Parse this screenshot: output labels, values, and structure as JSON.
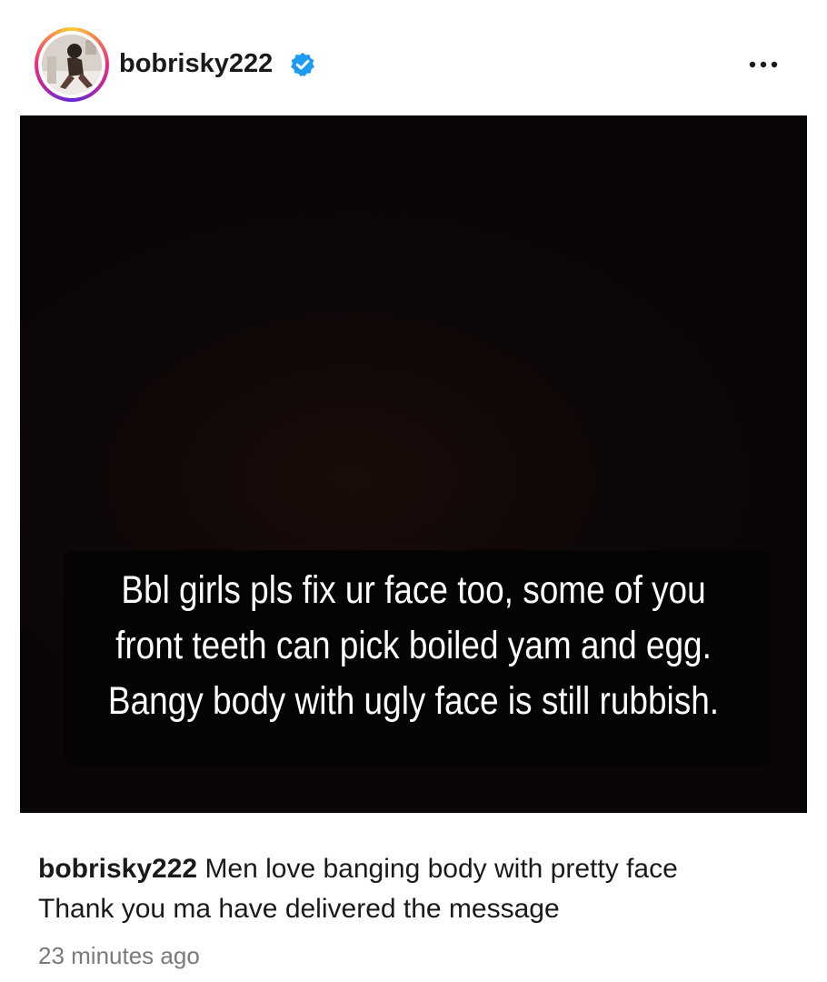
{
  "post": {
    "username": "bobrisky222",
    "verified": true,
    "verified_icon": "verified-badge-icon",
    "more_icon": "more-options-icon",
    "accent_color": "#1d9bf0",
    "image": {
      "overlay_text": "Bbl girls pls fix ur face too, some of you front teeth can pick boiled yam and egg. Bangy body with ugly face is still rubbish."
    },
    "caption": {
      "username": "bobrisky222",
      "line1": "Men love banging body with pretty face",
      "line2": "Thank you ma have delivered the message"
    },
    "timestamp": "23 minutes ago"
  }
}
